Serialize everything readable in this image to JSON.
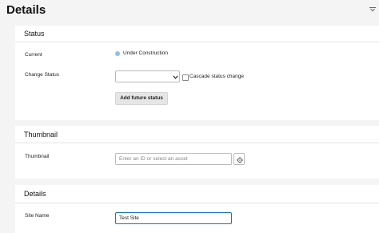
{
  "page": {
    "title": "Details"
  },
  "status_panel": {
    "heading": "Status",
    "current_label": "Current",
    "current_value": "Under Construction",
    "change_status_label": "Change Status",
    "change_status_selected": "",
    "cascade_label": "Cascade status change",
    "cascade_checked": false,
    "add_future_label": "Add future status",
    "status_dot_color": "#8cc2e6"
  },
  "thumbnail_panel": {
    "heading": "Thumbnail",
    "thumbnail_label": "Thumbnail",
    "asset_placeholder": "Enter an ID or select an asset"
  },
  "details_panel": {
    "heading": "Details",
    "site_name_label": "Site Name",
    "site_name_value": "Test Site"
  },
  "colors": {
    "focus_border": "#1a73c8",
    "background": "#f4f4f4"
  }
}
